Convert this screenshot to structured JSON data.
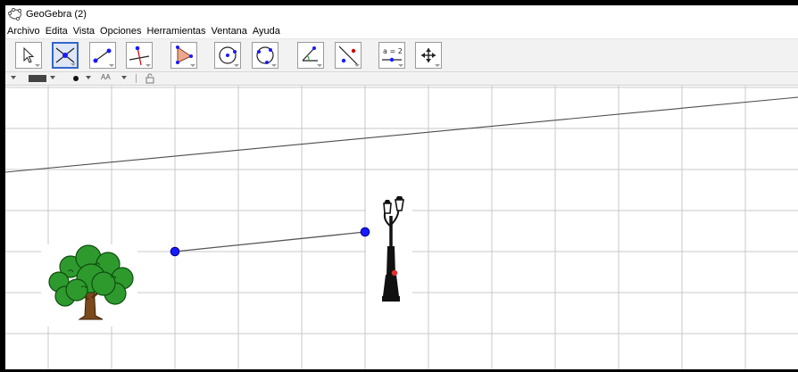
{
  "window": {
    "title": "GeoGebra (2)"
  },
  "menu": [
    "Archivo",
    "Edita",
    "Vista",
    "Opciones",
    "Herramientas",
    "Ventana",
    "Ayuda"
  ],
  "toolbar": {
    "tools": [
      {
        "name": "move-tool",
        "icon": "arrow-pointer-icon"
      },
      {
        "name": "point-tool",
        "icon": "intersect-point-icon",
        "active": true
      },
      {
        "name": "segment-tool",
        "icon": "segment-icon"
      },
      {
        "name": "perpendicular-line-tool",
        "icon": "perpendicular-icon"
      },
      {
        "name": "polygon-tool",
        "icon": "polygon-icon"
      },
      {
        "name": "circle-tool",
        "icon": "circle-center-point-icon"
      },
      {
        "name": "circle-three-points-tool",
        "icon": "circle-three-points-icon"
      },
      {
        "name": "angle-tool",
        "icon": "angle-icon"
      },
      {
        "name": "reflect-tool",
        "icon": "reflect-line-icon"
      },
      {
        "name": "slider-tool",
        "icon": "slider-icon",
        "label": "a = 2"
      },
      {
        "name": "move-graphics-view-tool",
        "icon": "move-view-icon"
      }
    ]
  },
  "stylebar": {
    "font_size_label": "AA"
  },
  "colors": {
    "accent": "#3366cc",
    "point": "#1a1aff",
    "grid": "#c8c8c8",
    "line": "#4d4d4d"
  }
}
